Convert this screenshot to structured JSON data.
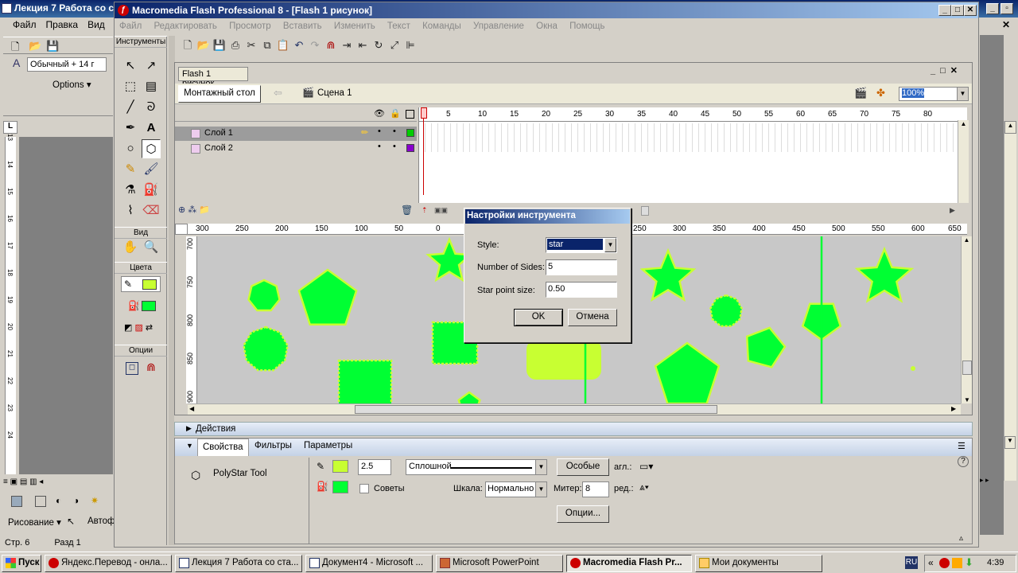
{
  "word": {
    "title": "Лекция 7 Работа со с",
    "menu": [
      "Файл",
      "Правка",
      "Вид"
    ],
    "style_box": "Обычный + 14 г",
    "options_label": "Options",
    "draw_label": "Рисование",
    "autoshapes_label": "Автоф",
    "status_page": "Стр. 6",
    "status_section": "Разд 1",
    "vruler_numbers": [
      "13",
      "14",
      "15",
      "16",
      "17",
      "18",
      "19",
      "20",
      "21",
      "22",
      "23",
      "24"
    ]
  },
  "flash": {
    "title": "Macromedia Flash Professional 8 - [Flash 1 рисунок]",
    "menu": [
      "Файл",
      "Редактировать",
      "Просмотр",
      "Вставить",
      "Изменить",
      "Текст",
      "Команды",
      "Управление",
      "Окна",
      "Помощь"
    ],
    "tools_header": "Инструменты",
    "view_header": "Вид",
    "colors_header": "Цвета",
    "options_header": "Опции",
    "doc_tab": "Flash 1 рисунок",
    "timeline_btn": "Монтажный стол",
    "scene_label": "Сцена 1",
    "zoom": "100%",
    "layers": [
      "Слой 1",
      "Слой 2"
    ],
    "frame_numbers": [
      "1",
      "5",
      "10",
      "15",
      "20",
      "25",
      "30",
      "35",
      "40",
      "45",
      "50",
      "55",
      "60",
      "65",
      "70",
      "75",
      "80"
    ],
    "ruler_h_labels": [
      "300",
      "250",
      "200",
      "150",
      "100",
      "50",
      "0",
      "250",
      "300",
      "350",
      "400",
      "450",
      "500",
      "550",
      "600",
      "650"
    ],
    "ruler_v_labels": [
      "700",
      "750",
      "800",
      "850",
      "900"
    ],
    "actions_label": "Действия",
    "props_tabs": [
      "Свойства",
      "Фильтры",
      "Параметры"
    ],
    "tool_name": "PolyStar Tool",
    "stroke_width": "2.5",
    "stroke_style": "Сплошной",
    "custom_btn": "Особые",
    "cap_label": "агл.:",
    "hints_label": "Советы",
    "scale_label": "Шкала:",
    "scale_value": "Нормально",
    "miter_label": "Митер:",
    "miter_value": "8",
    "join_label": "ред.:",
    "options_btn": "Опции...",
    "stroke_color": "#c8ff32",
    "fill_color": "#00ff33",
    "stage_color": "#c8c8c8"
  },
  "dialog": {
    "title": "Настройки инструмента",
    "style_label": "Style:",
    "style_value": "star",
    "sides_label": "Number of Sides:",
    "sides_value": "5",
    "point_label": "Star point size:",
    "point_value": "0.50",
    "ok": "OK",
    "cancel": "Отмена"
  },
  "taskbar": {
    "start": "Пуск",
    "tasks": [
      "Яндекс.Перевод - онла...",
      "Лекция 7 Работа со ста...",
      "Документ4 - Microsoft ...",
      "Microsoft PowerPoint",
      "Macromedia Flash Pr...",
      "Мои документы"
    ],
    "lang": "RU",
    "clock": "4:39"
  }
}
